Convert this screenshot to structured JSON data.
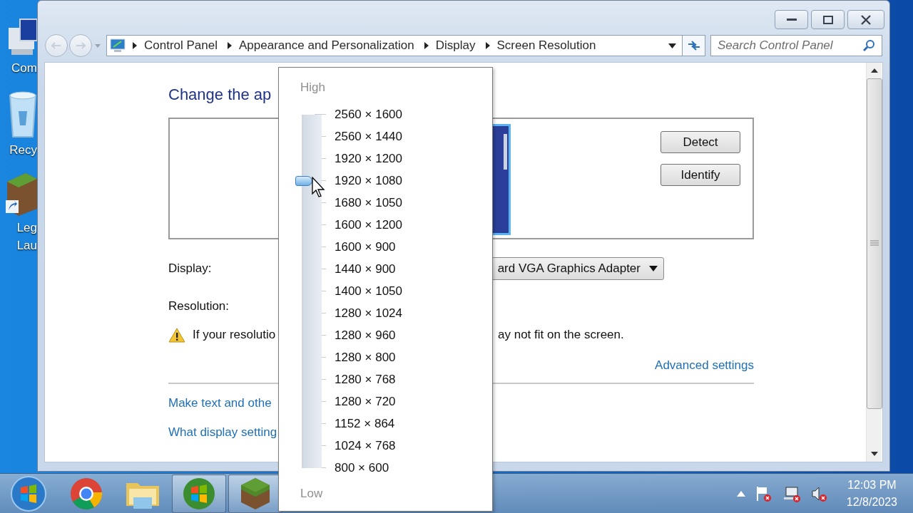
{
  "desktop_icons": [
    {
      "label": "Com"
    },
    {
      "label": "Recy"
    },
    {
      "label": "Leg Lau"
    }
  ],
  "address_bar": {
    "breadcrumbs": [
      "Control Panel",
      "Appearance and Personalization",
      "Display",
      "Screen Resolution"
    ]
  },
  "search": {
    "placeholder": "Search Control Panel"
  },
  "page": {
    "title": "Change the ap",
    "buttons": [
      "Detect",
      "Identify"
    ],
    "display_label": "Display:",
    "display_value": "ard VGA Graphics Adapter",
    "resolution_label": "Resolution:",
    "warning_left": "If your resolutio",
    "warning_right": "ay not fit on the screen.",
    "advanced_link": "Advanced settings",
    "links": [
      "Make text and othe",
      "What display setting"
    ]
  },
  "resolution_popup": {
    "high_label": "High",
    "low_label": "Low",
    "level": 0.8125,
    "options": [
      "2560 × 1600",
      "2560 × 1440",
      "1920 × 1200",
      "1920 × 1080",
      "1680 × 1050",
      "1600 × 1200",
      "1600 × 900",
      "1440 × 900",
      "1400 × 1050",
      "1280 × 1024",
      "1280 × 960",
      "1280 × 800",
      "1280 × 768",
      "1280 × 720",
      "1152 × 864",
      "1024 × 768",
      "800 × 600"
    ]
  },
  "taskbar": {
    "apps": [
      {
        "running": false
      },
      {
        "running": false
      },
      {
        "running": true
      },
      {
        "running": true
      }
    ],
    "time": "12:03 PM",
    "date": "12/8/2023"
  }
}
